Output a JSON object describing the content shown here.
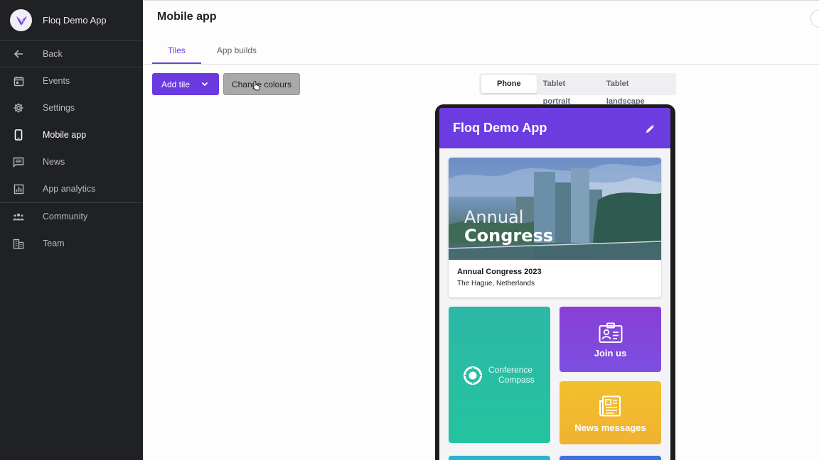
{
  "sidebar": {
    "app_name": "Floq Demo App",
    "back_label": "Back",
    "items": [
      {
        "label": "Events",
        "icon": "calendar-icon"
      },
      {
        "label": "Settings",
        "icon": "gear-icon"
      },
      {
        "label": "Mobile app",
        "icon": "phone-icon",
        "active": true
      },
      {
        "label": "News",
        "icon": "message-icon"
      },
      {
        "label": "App analytics",
        "icon": "chart-icon"
      },
      {
        "label": "Community",
        "icon": "people-icon"
      },
      {
        "label": "Team",
        "icon": "building-icon"
      }
    ]
  },
  "header": {
    "title": "Mobile app",
    "tabs": [
      {
        "label": "Tiles",
        "active": true
      },
      {
        "label": "App builds"
      }
    ]
  },
  "toolbar": {
    "add_tile_label": "Add tile",
    "change_colours_label": "Change colours",
    "device_options": [
      {
        "label": "Phone",
        "active": true
      },
      {
        "label": "Tablet portrait"
      },
      {
        "label": "Tablet landscape"
      }
    ]
  },
  "preview": {
    "app_title": "Floq Demo App",
    "hero": {
      "image_text_line1": "Annual",
      "image_text_line2": "Congress",
      "title": "Annual Congress 2023",
      "subtitle": "The Hague, Netherlands"
    },
    "tiles": {
      "compass_line1": "Conference",
      "compass_line2": "Compass",
      "join_label": "Join us",
      "news_label": "News messages"
    }
  },
  "colors": {
    "accent": "#6c3ce1",
    "sidebar_bg": "#202124",
    "compass_tile": "#24c3a0",
    "join_tile": "#8a3ed6",
    "news_tile": "#f3c02c"
  }
}
